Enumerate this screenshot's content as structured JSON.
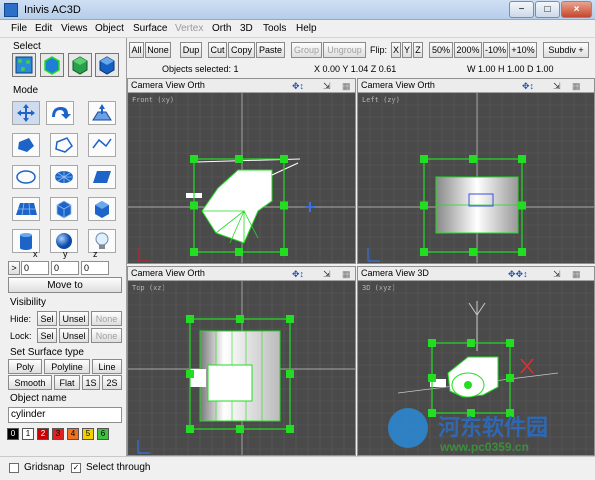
{
  "window": {
    "title": "Inivis AC3D",
    "min": "−",
    "max": "□",
    "close": "×"
  },
  "menu": [
    "File",
    "Edit",
    "Views",
    "Object",
    "Surface",
    "Vertex",
    "Orth",
    "3D",
    "Tools",
    "Help"
  ],
  "menu_disabled": [
    "Vertex"
  ],
  "left": {
    "select_title": "Select",
    "mode_title": "Mode",
    "coords": {
      "x_label": "x",
      "y_label": "y",
      "z_label": "z",
      "arrow": ">",
      "x": "0",
      "y": "0",
      "z": "0",
      "move_to": "Move to"
    },
    "visibility_title": "Visibility",
    "hide_label": "Hide:",
    "lock_label": "Lock:",
    "sel": "Sel",
    "unsel": "Unsel",
    "none": "None",
    "surface_title": "Set Surface type",
    "poly": "Poly",
    "polyline": "Polyline",
    "line": "Line",
    "smooth": "Smooth",
    "flat": "Flat",
    "one_s": "1S",
    "two_s": "2S",
    "object_name_title": "Object name",
    "object_name": "cylinder",
    "palette": [
      {
        "label": "0",
        "color": "#000000"
      },
      {
        "label": "1",
        "color": "#ffffff"
      },
      {
        "label": "2",
        "color": "#cc0000"
      },
      {
        "label": "3",
        "color": "#e02020"
      },
      {
        "label": "4",
        "color": "#f07020"
      },
      {
        "label": "5",
        "color": "#f0d000"
      },
      {
        "label": "6",
        "color": "#40c040"
      }
    ]
  },
  "toolbar": {
    "all": "All",
    "none": "None",
    "dup": "Dup",
    "cut": "Cut",
    "copy": "Copy",
    "paste": "Paste",
    "group": "Group",
    "ungroup": "Ungroup",
    "flip": "Flip:",
    "x": "X",
    "y": "Y",
    "z": "Z",
    "z50": "50%",
    "z200": "200%",
    "m10": "-10%",
    "p10": "+10%",
    "subdiv": "Subdiv +"
  },
  "info": {
    "selected": "Objects selected: 1",
    "pos": "X 0.00 Y 1.04 Z 0.61",
    "size": "W 1.00 H 1.00 D 1.00"
  },
  "viewports": [
    {
      "menu": "Camera View Orth",
      "label": "Front (xy)"
    },
    {
      "menu": "Camera View Orth",
      "label": "Left (zy)"
    },
    {
      "menu": "Camera View Orth",
      "label": "Top (xz)"
    },
    {
      "menu": "Camera View 3D",
      "label": "3D (xyz)"
    }
  ],
  "status": {
    "gridsnap": "Gridsnap",
    "gridsnap_checked": false,
    "select_through": "Select through",
    "select_through_checked": true,
    "check_mark": "✓"
  },
  "watermark": {
    "title": "河东软件园",
    "url": "www.pc0359.cn"
  },
  "colors": {
    "selection_handle": "#22dd22",
    "viewport_bg": "#4a4a4a",
    "grid": "#5c5c5c",
    "axis": "#d0d0d0"
  }
}
